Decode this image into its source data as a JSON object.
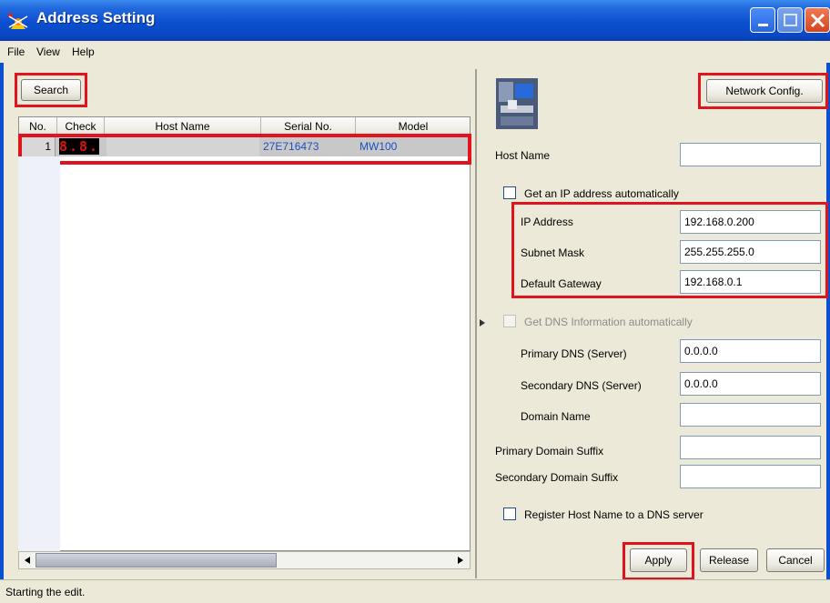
{
  "window": {
    "title": "Address Setting",
    "colors": {
      "title_bar": "#0a4fd0",
      "highlight": "#e0141e",
      "link_text": "#1b4fc0",
      "led": "#e01010"
    }
  },
  "menu": {
    "items": [
      "File",
      "View",
      "Help"
    ]
  },
  "left": {
    "search_label": "Search",
    "table": {
      "columns": [
        "No.",
        "Check",
        "Host Name",
        "Serial No.",
        "Model"
      ],
      "rows": [
        {
          "no": "1",
          "check": "8.8.",
          "host_name": "",
          "serial": "27E716473",
          "model": "MW100"
        }
      ]
    }
  },
  "right": {
    "network_config_label": "Network Config.",
    "host_name": {
      "label": "Host Name",
      "value": ""
    },
    "auto_ip": {
      "label": "Get an IP address automatically",
      "checked": false
    },
    "ip_address": {
      "label": "IP Address",
      "value": "192.168.0.200"
    },
    "subnet_mask": {
      "label": "Subnet Mask",
      "value": "255.255.255.0"
    },
    "default_gateway": {
      "label": "Default Gateway",
      "value": "192.168.0.1"
    },
    "auto_dns": {
      "label": "Get DNS Information automatically",
      "checked": false,
      "enabled": false
    },
    "primary_dns": {
      "label": "Primary DNS (Server)",
      "value": "0.0.0.0"
    },
    "secondary_dns": {
      "label": "Secondary DNS (Server)",
      "value": "0.0.0.0"
    },
    "domain_name": {
      "label": "Domain Name",
      "value": ""
    },
    "primary_suffix": {
      "label": "Primary Domain Suffix",
      "value": ""
    },
    "secondary_suffix": {
      "label": "Secondary Domain Suffix",
      "value": ""
    },
    "register_host": {
      "label": "Register Host Name to a DNS server",
      "checked": false
    },
    "apply_label": "Apply",
    "release_label": "Release",
    "cancel_label": "Cancel"
  },
  "status": {
    "text": "Starting the edit."
  }
}
